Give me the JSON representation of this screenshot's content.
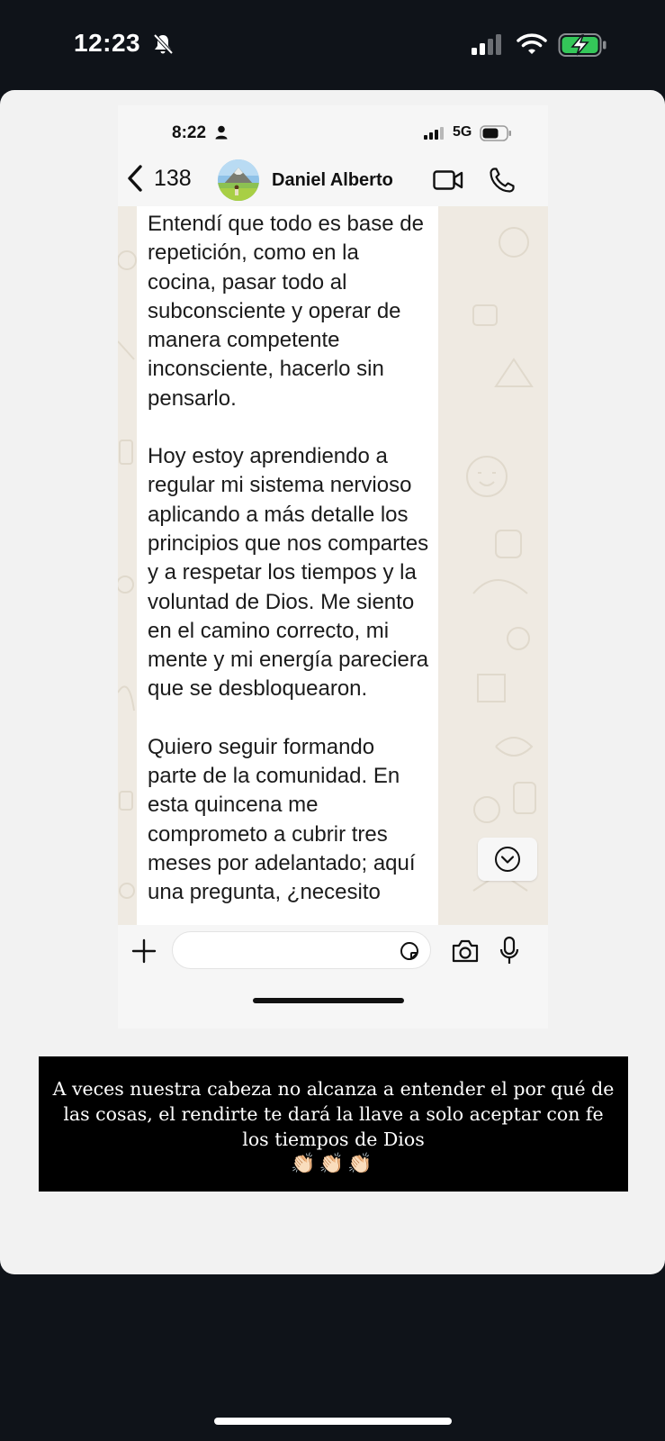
{
  "outer_status": {
    "time": "12:23",
    "icons": [
      "bell-slash-icon",
      "cellular-signal-icon",
      "wifi-icon",
      "battery-charging-icon"
    ]
  },
  "embedded_status": {
    "time": "8:22",
    "network": "5G",
    "icons": [
      "person-icon",
      "cellular-signal-icon",
      "battery-icon"
    ]
  },
  "chat_header": {
    "back_count": "138",
    "contact_name": "Daniel Alberto",
    "icons": [
      "chevron-left-icon",
      "video-call-icon",
      "phone-call-icon"
    ]
  },
  "message": {
    "paragraphs": [
      "Entendí que todo es base de repetición, como en la cocina, pasar todo al subconsciente y operar de manera competente inconsciente, hacerlo sin pensarlo.",
      "Hoy estoy aprendiendo a regular mi sistema nervioso aplicando a más detalle los principios que nos compartes y a respetar los tiempos y la voluntad de Dios. Me siento en el camino correcto, mi mente y mi energía pareciera que se desbloquearon.",
      "Quiero seguir formando parte de la comunidad. En esta quincena me comprometo a cubrir tres meses por adelantado; aquí una pregunta, ¿necesito"
    ]
  },
  "input_bar": {
    "placeholder": "",
    "icons": [
      "plus-icon",
      "sticker-icon",
      "camera-icon",
      "microphone-icon"
    ]
  },
  "caption": {
    "text": "A veces nuestra cabeza no alcanza a entender el por qué de las cosas, el rendirte te dará la llave a solo aceptar con fe los tiempos de Dios",
    "emoji": "👏🏻👏🏻👏🏻"
  },
  "colors": {
    "outer_background": "#0f1319",
    "card_background": "#f2f2f2",
    "chat_wallpaper": "#efeae2",
    "bubble": "#ffffff",
    "caption_background": "#000000",
    "battery_green": "#34c759"
  }
}
